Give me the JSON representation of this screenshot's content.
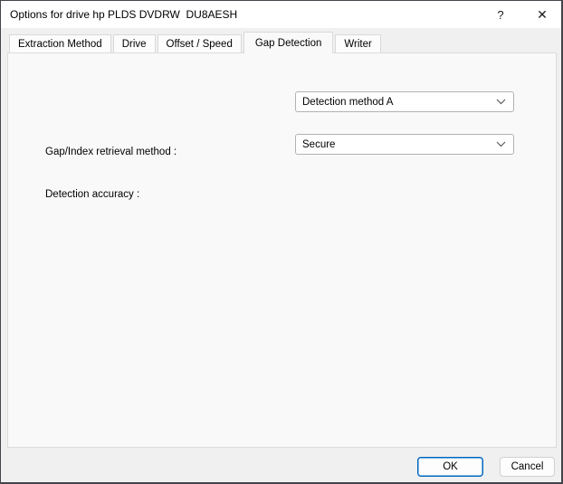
{
  "window": {
    "title": "Options for drive hp PLDS DVDRW  DU8AESH",
    "help_icon": "?",
    "close_icon": "✕"
  },
  "tabs": [
    {
      "label": "Extraction Method",
      "active": false
    },
    {
      "label": "Drive",
      "active": false
    },
    {
      "label": "Offset / Speed",
      "active": false
    },
    {
      "label": "Gap Detection",
      "active": true
    },
    {
      "label": "Writer",
      "active": false
    }
  ],
  "form": {
    "fields": [
      {
        "label": "Gap/Index retrieval method :",
        "value": "Detection method A"
      },
      {
        "label": "Detection accuracy :",
        "value": "Secure"
      }
    ]
  },
  "footer": {
    "ok_label": "OK",
    "cancel_label": "Cancel"
  },
  "colors": {
    "dialog_bg": "#F0F0F0",
    "panel_bg": "#F9F9F9",
    "titlebar_bg": "#FFFFFF",
    "accent_border": "#0067C0",
    "combobox_border": "#B2B2B2"
  }
}
